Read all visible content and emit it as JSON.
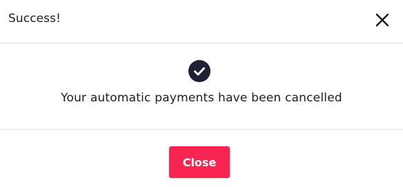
{
  "dialog": {
    "title": "Success!",
    "close_icon": "close-icon",
    "status_icon": "check-circle-icon",
    "message": "Your automatic payments have been cancelled",
    "close_button_label": "Close"
  },
  "colors": {
    "accent": "#f7254f",
    "icon_fill": "#1c2133",
    "text": "#1d1d1f",
    "divider": "#e3e3e3"
  }
}
